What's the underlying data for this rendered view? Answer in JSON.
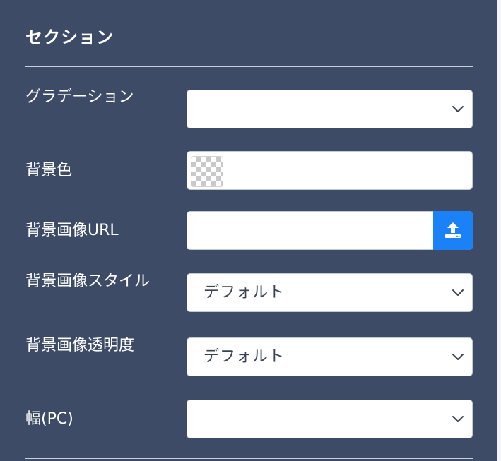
{
  "section": {
    "title": "セクション"
  },
  "fields": {
    "gradient": {
      "label": "グラデーション",
      "value": ""
    },
    "background_color": {
      "label": "背景色"
    },
    "background_image_url": {
      "label": "背景画像URL",
      "value": "",
      "placeholder": ""
    },
    "background_image_style": {
      "label": "背景画像スタイル",
      "value": "デフォルト"
    },
    "background_image_opacity": {
      "label": "背景画像透明度",
      "value": "デフォルト"
    },
    "width_pc": {
      "label": "幅(PC)",
      "value": ""
    }
  },
  "icons": {
    "select": "chevron-down-icon",
    "upload": "upload-icon",
    "swatch": "transparent-checkerboard"
  },
  "colors": {
    "panel_background": "#3d4b67",
    "accent": "#1a82f6",
    "text_on_panel": "#ffffff"
  }
}
